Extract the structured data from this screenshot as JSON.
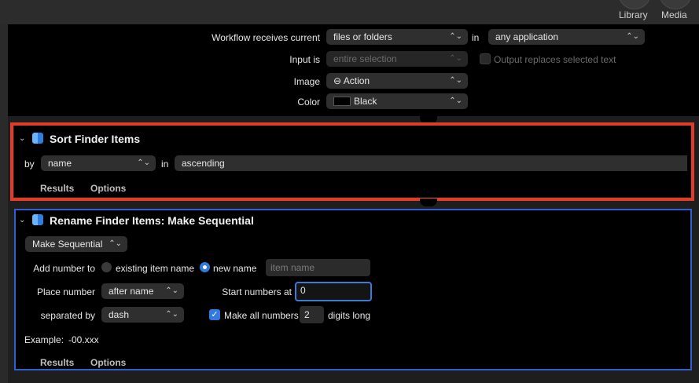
{
  "toolbar": {
    "library_label": "Library",
    "media_label": "Media"
  },
  "workflow": {
    "receives_label": "Workflow receives current",
    "receives_value": "files or folders",
    "in_label": "in",
    "app_value": "any application",
    "input_is_label": "Input is",
    "input_is_value": "entire selection",
    "output_replaces_label": "Output replaces selected text",
    "image_label": "Image",
    "image_value": "⊖ Action",
    "color_label": "Color",
    "color_value": "Black",
    "color_hex": "#000000"
  },
  "sort_action": {
    "title": "Sort Finder Items",
    "by_label": "by",
    "by_value": "name",
    "in_label": "in",
    "order_value": "ascending",
    "tab_results": "Results",
    "tab_options": "Options",
    "highlight_color": "#e23b2a"
  },
  "rename_action": {
    "title": "Rename Finder Items: Make Sequential",
    "mode_value": "Make Sequential",
    "add_number_label": "Add number to",
    "existing_item_label": "existing item name",
    "new_name_label": "new name",
    "new_name_placeholder": "item name",
    "place_number_label": "Place number",
    "place_number_value": "after name",
    "start_numbers_label": "Start numbers at",
    "start_numbers_value": "0",
    "separated_by_label": "separated by",
    "separated_by_value": "dash",
    "make_all_label": "Make all numbers",
    "digits_value": "2",
    "digits_long_label": "digits long",
    "example_label": "Example:",
    "example_value": "-00.xxx",
    "tab_results": "Results",
    "tab_options": "Options",
    "selected_color": "#2f5fd0"
  }
}
